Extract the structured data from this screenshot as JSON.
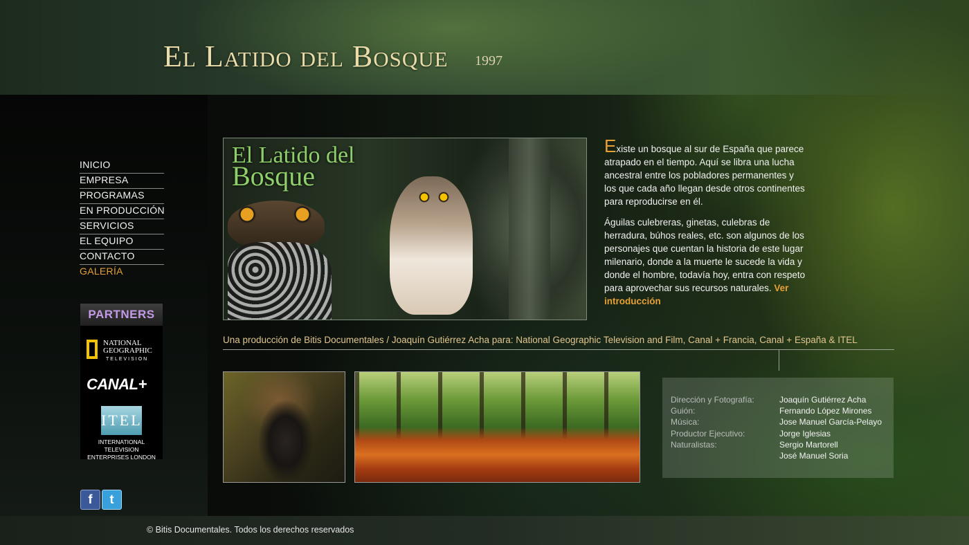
{
  "header": {
    "title": "El Latido del Bosque",
    "year": "1997"
  },
  "nav": {
    "items": [
      {
        "label": "INICIO"
      },
      {
        "label": "EMPRESA"
      },
      {
        "label": "PROGRAMAS"
      },
      {
        "label": "EN PRODUCCIÓN"
      },
      {
        "label": "SERVICIOS"
      },
      {
        "label": "EL EQUIPO"
      },
      {
        "label": "CONTACTO"
      },
      {
        "label": "GALERÍA"
      }
    ],
    "active": "GALERÍA",
    "active_color": "#e6a036"
  },
  "partners": {
    "heading": "PARTNERS",
    "natgeo": {
      "line1": "NATIONAL",
      "line2": "GEOGRAPHIC",
      "line3": "TELEVISION"
    },
    "canal": "CANAL+",
    "itel": {
      "logo": "ITEL",
      "line1": "INTERNATIONAL TELEVISION",
      "line2": "ENTERPRISES LONDON"
    }
  },
  "social": {
    "facebook": "f",
    "twitter": "t"
  },
  "hero": {
    "title_line1": "El Latido del",
    "title_line2": "Bosque"
  },
  "description": {
    "p1_first": "E",
    "p1_rest": "xiste un bosque al sur de España que parece atrapado en el tiempo.  Aquí se libra una lucha ancestral entre los pobladores permanentes y los que cada año llegan desde otros continentes para reproducirse en él.",
    "p2": "Águilas culebreras, ginetas, culebras de herradura, búhos reales, etc. son algunos de los personajes que cuentan la historia de este lugar milenario,  donde a la muerte le sucede la vida y donde el hombre, todavía hoy, entra con respeto para aprovechar sus recursos naturales. ",
    "link": "Ver introducción"
  },
  "credit_line": "Una producción de Bitis Documentales / Joaquín Gutiérrez Acha para: National Geographic Television and Film, Canal + Francia, Canal + España & ITEL",
  "crew": [
    {
      "role": "Dirección y Fotografía:",
      "name": "Joaquín Gutiérrez Acha"
    },
    {
      "role": "Guión:",
      "name": "Fernando López Mirones"
    },
    {
      "role": "Música:",
      "name": "Jose Manuel García-Pelayo"
    },
    {
      "role": "Productor Ejecutivo:",
      "name": "Jorge Iglesias"
    },
    {
      "role": "Naturalistas:",
      "name": "Sergio Martorell"
    },
    {
      "role": "",
      "name": "José Manuel Soria"
    }
  ],
  "footer": {
    "copyright": "© Bitis Documentales. Todos los derechos reservados"
  },
  "colors": {
    "accent": "#e6a036",
    "title": "#eadcaa",
    "credit": "#e1c68f"
  }
}
